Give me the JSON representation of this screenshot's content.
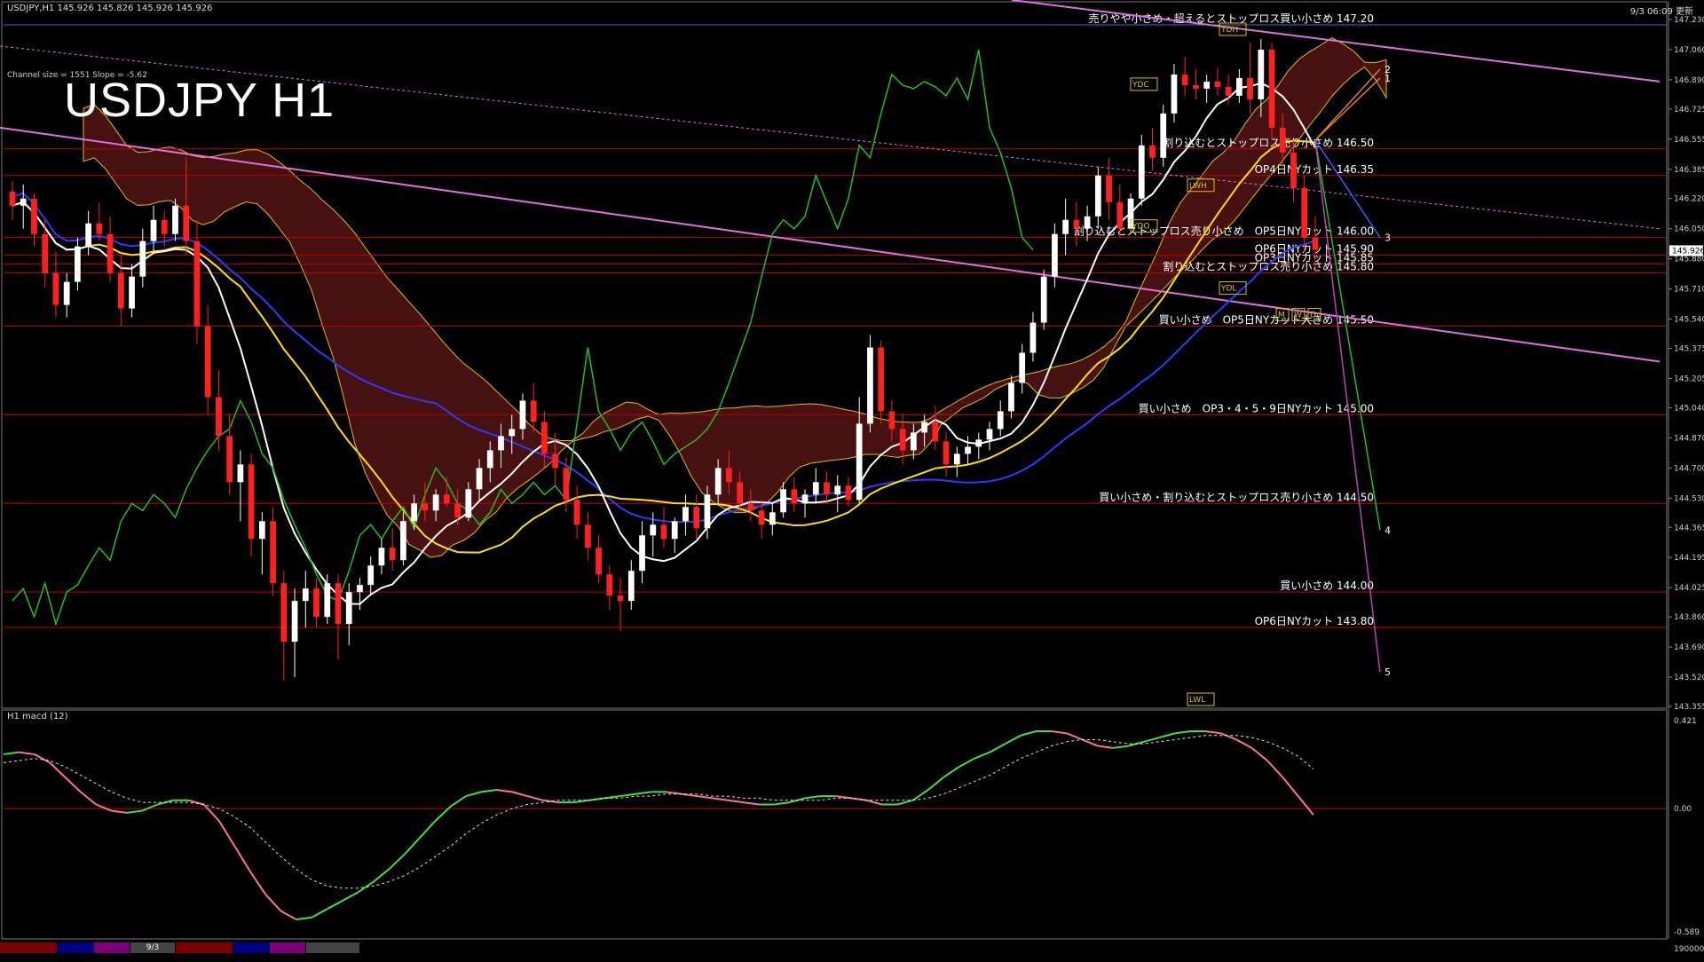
{
  "header": {
    "symbol_line": "USDJPY,H1  145.926 145.826 145.926 145.926",
    "time_line": "9/3 06:09 更新"
  },
  "title": "USDJPY H1",
  "channel_info": "Channel size = 1551 Slope = -5.62",
  "macd_label": "H1  macd (12)",
  "colors": {
    "background": "#000000",
    "bull_candle": "#ffffff",
    "bear_candle": "#ff2020",
    "level_line": "#c00000",
    "channel_line": "#e070e0",
    "kumo": "#cc3030",
    "ma_blue": "#2a3cff",
    "ma_yellow": "#ffe000",
    "ma_white": "#ffffff",
    "chikou": "#20c020",
    "macd_up": "#40e040",
    "macd_down": "#ff70a0"
  },
  "chart_data": [
    {
      "type": "candlestick",
      "symbol": "USDJPY",
      "timeframe": "H1",
      "price_axis": {
        "range": [
          143.355,
          147.23
        ],
        "ticks": [
          "147.230",
          "147.060",
          "146.890",
          "146.725",
          "146.555",
          "146.385",
          "146.220",
          "146.050",
          "145.880",
          "145.710",
          "145.540",
          "145.375",
          "145.205",
          "145.040",
          "144.870",
          "144.700",
          "144.530",
          "144.365",
          "144.195",
          "144.025",
          "143.860",
          "143.690",
          "143.520",
          "143.355"
        ],
        "current_price": "145.926"
      },
      "x_label": "9/3",
      "levels": [
        {
          "price": 147.2,
          "label": "売りやや小さめ・超えるとストップロス買い小さめ 147.20",
          "color": "#4466cc"
        },
        {
          "price": 146.5,
          "label": "割り込むとストップロス売り小さめ 146.50",
          "color": "#c00000"
        },
        {
          "price": 146.35,
          "label": "OP4日NYカット 146.35",
          "color": "#c00000"
        },
        {
          "price": 146.0,
          "label": "割り込むとストップロス売り小さめ　OP5日NYカット 146.00",
          "color": "#c00000"
        },
        {
          "price": 145.9,
          "label": "OP6日NYカット 145.90",
          "color": "#c00000"
        },
        {
          "price": 145.85,
          "label": "OP3日NYカット 145.85",
          "color": "#c00000"
        },
        {
          "price": 145.8,
          "label": "割り込むとストップロス売り小さめ 145.80",
          "color": "#c00000"
        },
        {
          "price": 145.5,
          "label": "買い小さめ　OP5日NYカット大きめ 145.50",
          "color": "#c00000"
        },
        {
          "price": 145.0,
          "label": "買い小さめ　OP3・4・5・9日NYカット 145.00",
          "color": "#c00000"
        },
        {
          "price": 144.5,
          "label": "買い小さめ・割り込むとストップロス売り小さめ 144.50",
          "color": "#c00000"
        },
        {
          "price": 144.0,
          "label": "買い小さめ 144.00",
          "color": "#c00000"
        },
        {
          "price": 143.8,
          "label": "OP6日NYカット 143.80",
          "color": "#c00000"
        }
      ],
      "tags": [
        "YDH",
        "YDC",
        "YDO",
        "YDL",
        "LWH",
        "LWL",
        "M",
        "W",
        "D"
      ],
      "wave_labels": [
        "1",
        "2",
        "3",
        "4",
        "5"
      ],
      "candles": [
        [
          146.26,
          146.32,
          146.1,
          146.18
        ],
        [
          146.18,
          146.3,
          146.05,
          146.22
        ],
        [
          146.22,
          146.25,
          145.95,
          146.02
        ],
        [
          146.02,
          146.1,
          145.72,
          145.8
        ],
        [
          145.8,
          145.92,
          145.55,
          145.62
        ],
        [
          145.62,
          145.8,
          145.55,
          145.75
        ],
        [
          145.75,
          146.0,
          145.7,
          145.95
        ],
        [
          145.95,
          146.15,
          145.9,
          146.08
        ],
        [
          146.08,
          146.2,
          145.98,
          146.02
        ],
        [
          146.02,
          146.12,
          145.75,
          145.8
        ],
        [
          145.8,
          145.9,
          145.5,
          145.6
        ],
        [
          145.6,
          145.85,
          145.55,
          145.78
        ],
        [
          145.78,
          146.05,
          145.72,
          145.98
        ],
        [
          145.98,
          146.18,
          145.92,
          146.1
        ],
        [
          146.1,
          146.15,
          145.95,
          146.02
        ],
        [
          146.02,
          146.22,
          145.98,
          146.18
        ],
        [
          146.18,
          146.45,
          145.9,
          145.98
        ],
        [
          145.98,
          146.1,
          145.4,
          145.5
        ],
        [
          145.5,
          145.62,
          145.0,
          145.1
        ],
        [
          145.1,
          145.25,
          144.8,
          144.88
        ],
        [
          144.88,
          145.0,
          144.55,
          144.62
        ],
        [
          144.62,
          144.8,
          144.4,
          144.72
        ],
        [
          144.72,
          144.78,
          144.2,
          144.3
        ],
        [
          144.3,
          144.45,
          144.1,
          144.4
        ],
        [
          144.4,
          144.48,
          143.98,
          144.05
        ],
        [
          144.05,
          144.12,
          143.5,
          143.72
        ],
        [
          143.72,
          144.02,
          143.52,
          143.95
        ],
        [
          143.95,
          144.12,
          143.8,
          144.02
        ],
        [
          144.02,
          144.08,
          143.8,
          143.86
        ],
        [
          143.86,
          144.1,
          143.82,
          144.05
        ],
        [
          144.05,
          144.1,
          143.62,
          143.82
        ],
        [
          143.82,
          144.05,
          143.7,
          144.0
        ],
        [
          144.0,
          144.08,
          143.9,
          144.04
        ],
        [
          144.04,
          144.2,
          143.98,
          144.15
        ],
        [
          144.15,
          144.3,
          144.1,
          144.25
        ],
        [
          144.25,
          144.36,
          144.12,
          144.18
        ],
        [
          144.18,
          144.45,
          144.15,
          144.4
        ],
        [
          144.4,
          144.55,
          144.35,
          144.5
        ],
        [
          144.5,
          144.62,
          144.4,
          144.46
        ],
        [
          144.46,
          144.58,
          144.4,
          144.55
        ],
        [
          144.55,
          144.65,
          144.48,
          144.5
        ],
        [
          144.5,
          144.58,
          144.38,
          144.42
        ],
        [
          144.42,
          144.62,
          144.4,
          144.58
        ],
        [
          144.58,
          144.75,
          144.52,
          144.7
        ],
        [
          144.7,
          144.85,
          144.62,
          144.8
        ],
        [
          144.8,
          144.95,
          144.7,
          144.88
        ],
        [
          144.88,
          145.0,
          144.78,
          144.92
        ],
        [
          144.92,
          145.12,
          144.86,
          145.08
        ],
        [
          145.08,
          145.18,
          144.9,
          144.96
        ],
        [
          144.96,
          145.02,
          144.7,
          144.78
        ],
        [
          144.78,
          144.9,
          144.6,
          144.7
        ],
        [
          144.7,
          144.76,
          144.45,
          144.52
        ],
        [
          144.52,
          144.6,
          144.3,
          144.38
        ],
        [
          144.38,
          144.45,
          144.18,
          144.25
        ],
        [
          144.25,
          144.32,
          144.05,
          144.1
        ],
        [
          144.1,
          144.15,
          143.9,
          143.98
        ],
        [
          143.98,
          144.08,
          143.78,
          143.95
        ],
        [
          143.95,
          144.18,
          143.9,
          144.12
        ],
        [
          144.12,
          144.4,
          144.05,
          144.32
        ],
        [
          144.32,
          144.45,
          144.2,
          144.38
        ],
        [
          144.38,
          144.48,
          144.25,
          144.3
        ],
        [
          144.3,
          144.42,
          144.22,
          144.4
        ],
        [
          144.4,
          144.55,
          144.32,
          144.48
        ],
        [
          144.48,
          144.55,
          144.3,
          144.36
        ],
        [
          144.36,
          144.6,
          144.3,
          144.55
        ],
        [
          144.55,
          144.75,
          144.5,
          144.7
        ],
        [
          144.7,
          144.8,
          144.55,
          144.62
        ],
        [
          144.62,
          144.68,
          144.45,
          144.5
        ],
        [
          144.5,
          144.58,
          144.4,
          144.46
        ],
        [
          144.46,
          144.52,
          144.3,
          144.38
        ],
        [
          144.38,
          144.5,
          144.32,
          144.45
        ],
        [
          144.45,
          144.62,
          144.42,
          144.58
        ],
        [
          144.58,
          144.65,
          144.45,
          144.5
        ],
        [
          144.5,
          144.58,
          144.42,
          144.55
        ],
        [
          144.55,
          144.7,
          144.5,
          144.62
        ],
        [
          144.62,
          144.68,
          144.5,
          144.55
        ],
        [
          144.55,
          144.66,
          144.45,
          144.6
        ],
        [
          144.6,
          144.65,
          144.48,
          144.52
        ],
        [
          144.52,
          145.1,
          144.5,
          144.95
        ],
        [
          144.95,
          145.45,
          144.9,
          145.38
        ],
        [
          145.38,
          145.42,
          144.95,
          145.02
        ],
        [
          145.02,
          145.08,
          144.85,
          144.92
        ],
        [
          144.92,
          145.0,
          144.72,
          144.8
        ],
        [
          144.8,
          144.95,
          144.75,
          144.9
        ],
        [
          144.9,
          145.0,
          144.82,
          144.96
        ],
        [
          144.96,
          145.05,
          144.8,
          144.85
        ],
        [
          144.85,
          144.9,
          144.65,
          144.72
        ],
        [
          144.72,
          144.82,
          144.65,
          144.78
        ],
        [
          144.78,
          144.88,
          144.72,
          144.82
        ],
        [
          144.82,
          144.9,
          144.75,
          144.86
        ],
        [
          144.86,
          144.96,
          144.8,
          144.92
        ],
        [
          144.92,
          145.08,
          144.88,
          145.02
        ],
        [
          145.02,
          145.22,
          144.98,
          145.18
        ],
        [
          145.18,
          145.4,
          145.12,
          145.35
        ],
        [
          145.35,
          145.58,
          145.3,
          145.52
        ],
        [
          145.52,
          145.82,
          145.48,
          145.78
        ],
        [
          145.78,
          146.08,
          145.72,
          146.02
        ],
        [
          146.02,
          146.22,
          145.9,
          146.1
        ],
        [
          146.1,
          146.2,
          145.95,
          146.05
        ],
        [
          146.05,
          146.18,
          145.98,
          146.12
        ],
        [
          146.12,
          146.4,
          146.05,
          146.35
        ],
        [
          146.35,
          146.45,
          146.1,
          146.2
        ],
        [
          146.2,
          146.3,
          146.0,
          146.05
        ],
        [
          146.05,
          146.25,
          146.02,
          146.22
        ],
        [
          146.22,
          146.58,
          146.18,
          146.52
        ],
        [
          146.52,
          146.62,
          146.38,
          146.45
        ],
        [
          146.45,
          146.75,
          146.4,
          146.7
        ],
        [
          146.7,
          146.98,
          146.65,
          146.92
        ],
        [
          146.92,
          147.02,
          146.8,
          146.86
        ],
        [
          146.86,
          146.95,
          146.78,
          146.84
        ],
        [
          146.84,
          146.92,
          146.76,
          146.88
        ],
        [
          146.88,
          146.96,
          146.8,
          146.85
        ],
        [
          146.85,
          146.92,
          146.75,
          146.8
        ],
        [
          146.8,
          146.95,
          146.76,
          146.9
        ],
        [
          146.9,
          147.1,
          146.7,
          146.78
        ],
        [
          146.78,
          147.12,
          146.68,
          147.06
        ],
        [
          147.06,
          147.1,
          146.55,
          146.62
        ],
        [
          146.62,
          146.7,
          146.4,
          146.48
        ],
        [
          146.48,
          146.55,
          146.2,
          146.28
        ],
        [
          146.28,
          146.35,
          145.92,
          146.0
        ],
        [
          146.0,
          146.12,
          145.8,
          145.93
        ]
      ]
    },
    {
      "type": "line",
      "name": "macd (12)",
      "y_ticks": [
        "0.421",
        "0.00",
        "-0.589"
      ],
      "x_tick": "190000",
      "macd": [
        0.26,
        0.27,
        0.26,
        0.22,
        0.15,
        0.08,
        0.02,
        -0.01,
        -0.02,
        -0.01,
        0.02,
        0.04,
        0.04,
        0.02,
        -0.06,
        -0.18,
        -0.3,
        -0.41,
        -0.49,
        -0.53,
        -0.52,
        -0.48,
        -0.44,
        -0.4,
        -0.35,
        -0.29,
        -0.22,
        -0.14,
        -0.06,
        0.01,
        0.06,
        0.08,
        0.09,
        0.08,
        0.06,
        0.04,
        0.03,
        0.03,
        0.04,
        0.05,
        0.06,
        0.07,
        0.08,
        0.08,
        0.07,
        0.06,
        0.05,
        0.04,
        0.03,
        0.02,
        0.02,
        0.03,
        0.05,
        0.06,
        0.06,
        0.05,
        0.04,
        0.02,
        0.02,
        0.04,
        0.09,
        0.15,
        0.2,
        0.24,
        0.27,
        0.31,
        0.35,
        0.37,
        0.37,
        0.36,
        0.33,
        0.3,
        0.29,
        0.3,
        0.32,
        0.34,
        0.36,
        0.37,
        0.37,
        0.36,
        0.33,
        0.29,
        0.23,
        0.15,
        0.06,
        -0.03
      ],
      "signal": [
        0.22,
        0.23,
        0.24,
        0.23,
        0.2,
        0.16,
        0.12,
        0.08,
        0.05,
        0.03,
        0.03,
        0.03,
        0.03,
        0.02,
        0.0,
        -0.04,
        -0.09,
        -0.16,
        -0.23,
        -0.29,
        -0.34,
        -0.37,
        -0.38,
        -0.38,
        -0.37,
        -0.35,
        -0.32,
        -0.28,
        -0.23,
        -0.18,
        -0.12,
        -0.07,
        -0.03,
        0.0,
        0.02,
        0.03,
        0.04,
        0.04,
        0.04,
        0.05,
        0.05,
        0.06,
        0.06,
        0.07,
        0.07,
        0.07,
        0.06,
        0.06,
        0.05,
        0.05,
        0.04,
        0.04,
        0.04,
        0.04,
        0.05,
        0.05,
        0.04,
        0.04,
        0.04,
        0.04,
        0.05,
        0.07,
        0.1,
        0.13,
        0.16,
        0.2,
        0.24,
        0.27,
        0.3,
        0.32,
        0.33,
        0.33,
        0.32,
        0.31,
        0.31,
        0.32,
        0.33,
        0.34,
        0.35,
        0.35,
        0.35,
        0.34,
        0.32,
        0.29,
        0.25,
        0.19
      ]
    }
  ]
}
